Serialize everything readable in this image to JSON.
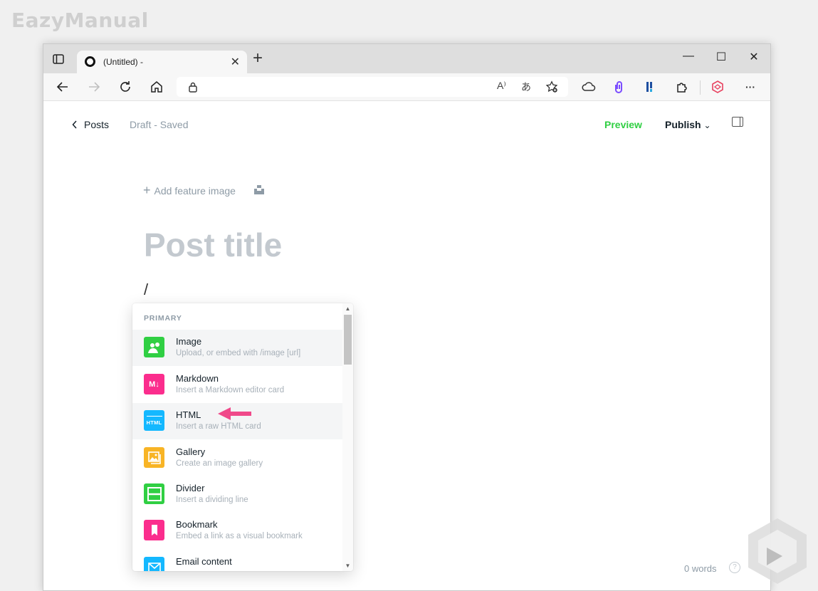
{
  "watermark": "EazyManual",
  "browser": {
    "tab_title": "(Untitled) -",
    "tab_close": "✕",
    "new_tab": "+",
    "window_controls": {
      "minimize": "—",
      "maximize": "☐",
      "close": "✕"
    },
    "read_aloud_icon": "A⁾",
    "translate_icon": "あ",
    "more_icon": "···"
  },
  "editor": {
    "back_label": "Posts",
    "status": "Draft - Saved",
    "preview_label": "Preview",
    "publish_label": "Publish",
    "publish_caret": "⌄",
    "feature_image_label": "Add feature image",
    "title_placeholder": "Post title",
    "slash_command": "/",
    "word_count": "0 words",
    "help_glyph": "?"
  },
  "card_menu": {
    "section": "PRIMARY",
    "items": [
      {
        "label": "Image",
        "description": "Upload, or embed with /image [url]",
        "icon": "image-icon",
        "color": "#30cf43",
        "glyph": ""
      },
      {
        "label": "Markdown",
        "description": "Insert a Markdown editor card",
        "icon": "markdown-icon",
        "color": "#fb2d8d",
        "glyph": "M↓"
      },
      {
        "label": "HTML",
        "description": "Insert a raw HTML card",
        "icon": "html-icon",
        "color": "#14b8ff",
        "glyph": "HTML"
      },
      {
        "label": "Gallery",
        "description": "Create an image gallery",
        "icon": "gallery-icon",
        "color": "#f8b425",
        "glyph": ""
      },
      {
        "label": "Divider",
        "description": "Insert a dividing line",
        "icon": "divider-icon",
        "color": "#30cf43",
        "glyph": ""
      },
      {
        "label": "Bookmark",
        "description": "Embed a link as a visual bookmark",
        "icon": "bookmark-icon",
        "color": "#fb2d8d",
        "glyph": ""
      },
      {
        "label": "Email content",
        "description": "",
        "icon": "email-icon",
        "color": "#14b8ff",
        "glyph": ""
      }
    ]
  },
  "colors": {
    "accent_green": "#30cf43",
    "annotation_arrow": "#f0498a"
  }
}
